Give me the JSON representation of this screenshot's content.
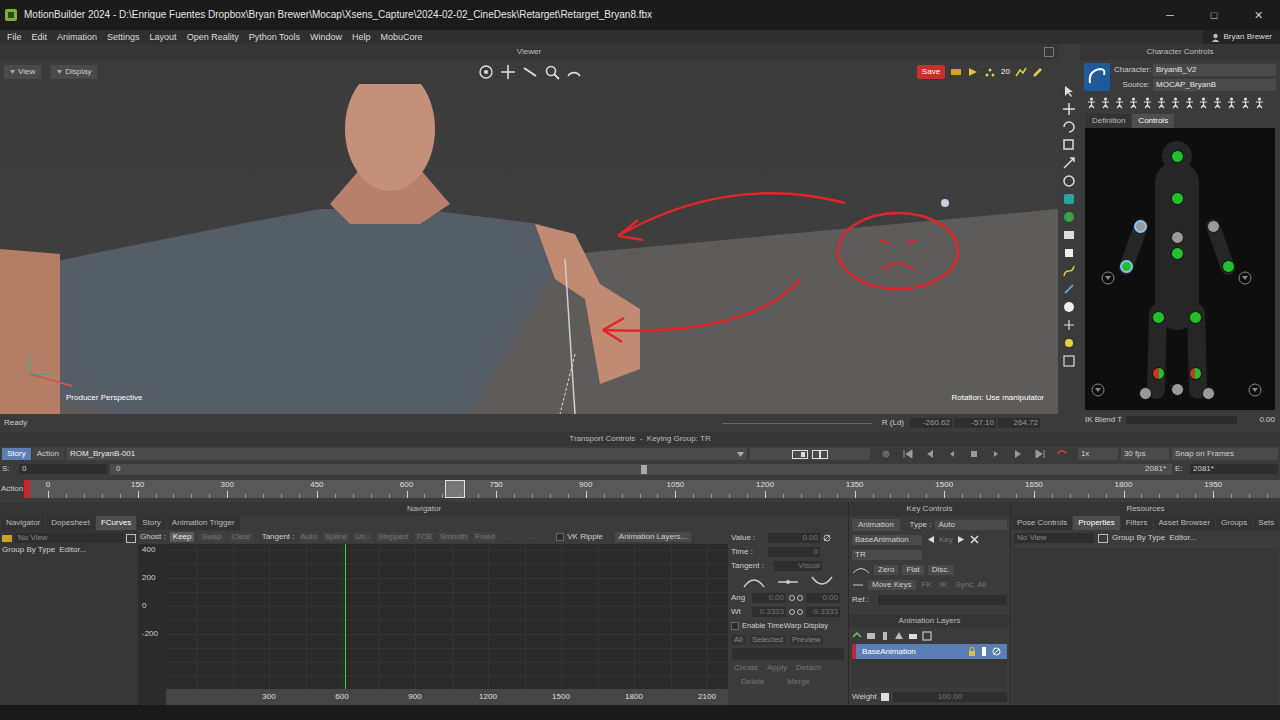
{
  "window": {
    "title": "MotionBuilder 2024 - D:\\Enrique Fuentes Dropbox\\Bryan Brewer\\Mocap\\Xsens_Capture\\2024-02-02_CineDesk\\Retarget\\Retarget_Bryan8.fbx",
    "controls": [
      "─",
      "□",
      "✕"
    ]
  },
  "menu": [
    "File",
    "Edit",
    "Animation",
    "Settings",
    "Layout",
    "Open Reality",
    "Python Tools",
    "Window",
    "Help",
    "MobuCore"
  ],
  "user": {
    "name": "Bryan Brewer"
  },
  "viewer": {
    "title": "Viewer",
    "buttons": [
      "View",
      "Display"
    ],
    "save": "Save",
    "speed": "20",
    "camera": "Producer Perspective",
    "hint": "Rotation: Use manipulator"
  },
  "status_bar": {
    "text": "Ready",
    "rot_label": "R (Ld)",
    "fields": [
      "-260.62",
      "-57.10",
      "264.72"
    ]
  },
  "character_controls": {
    "title": "Character Controls",
    "character_label": "Character:",
    "character": "BryanB_V2",
    "source_label": "Source:",
    "source": "MOCAP_BryanB",
    "tabs": [
      {
        "label": "Definition",
        "selected": false
      },
      {
        "label": "Controls",
        "selected": true
      }
    ],
    "effectors": [
      {
        "kind": "full",
        "color": "#22c02a",
        "color2": "#22c02a",
        "selected": false
      },
      {
        "kind": "full",
        "color": "#22c02a",
        "color2": "#22c02a",
        "selected": false
      },
      {
        "kind": "full",
        "color": "#9a9a9a",
        "color2": "#9a9a9a",
        "selected": true
      },
      {
        "kind": "full",
        "color": "#9a9a9a",
        "color2": "#9a9a9a",
        "selected": false
      },
      {
        "kind": "full",
        "color": "#9a9a9a",
        "color2": "#9a9a9a",
        "selected": false
      },
      {
        "kind": "full",
        "color": "#22c02a",
        "color2": "#22c02a",
        "selected": false
      },
      {
        "kind": "full",
        "color": "#22c02a",
        "color2": "#22c02a",
        "selected": true
      },
      {
        "kind": "full",
        "color": "#22c02a",
        "color2": "#22c02a",
        "selected": false
      },
      {
        "kind": "full",
        "color": "#22c02a",
        "color2": "#22c02a",
        "selected": false
      },
      {
        "kind": "full",
        "color": "#22c02a",
        "color2": "#22c02a",
        "selected": false
      },
      {
        "kind": "split",
        "color": "#c0392b",
        "color2": "#22c02a",
        "selected": false
      },
      {
        "kind": "split",
        "color": "#c0392b",
        "color2": "#22c02a",
        "selected": false
      },
      {
        "kind": "full",
        "color": "#9a9a9a",
        "color2": "#9a9a9a",
        "selected": false
      },
      {
        "kind": "full",
        "color": "#9a9a9a",
        "color2": "#9a9a9a",
        "selected": false
      },
      {
        "kind": "full",
        "color": "#9a9a9a",
        "color2": "#9a9a9a",
        "selected": false
      }
    ],
    "ik_blend_label": "IK Blend T",
    "ik_blend_value": "0.00"
  },
  "transport": {
    "title": "Transport Controls  -  Keying Group: TR",
    "tabs": [
      {
        "label": "Story",
        "selected": true
      },
      {
        "label": "Action",
        "selected": false
      }
    ],
    "take": "ROM_BryanB-001",
    "speed": "1x",
    "fps": "30 fps",
    "snap": "Snap on Frames",
    "start_label": "S:",
    "start": "0",
    "zoom_start": "0",
    "zoom_end": "2081*",
    "end_label": "E:",
    "end": "2081*",
    "zoom": {
      "level": 0.5
    },
    "ruler_label": "Action",
    "ruler_ticks": [
      "0",
      "150",
      "300",
      "450",
      "600",
      "750",
      "900",
      "1050",
      "1200",
      "1350",
      "1500",
      "1650",
      "1800",
      "1950"
    ],
    "playhead": {
      "level": 0.34
    }
  },
  "navigator": {
    "title": "Navigator",
    "tabs": [
      {
        "label": "Navigator",
        "selected": false
      },
      {
        "label": "Dopesheet",
        "selected": false
      },
      {
        "label": "FCurves",
        "selected": true
      },
      {
        "label": "Story",
        "selected": false
      },
      {
        "label": "Animation Trigger",
        "selected": false
      }
    ],
    "sidebar": {
      "view": "No View",
      "group": "Group By Type",
      "editor": "Editor..."
    },
    "ghost_label": "Ghost :",
    "ghost_buttons": [
      {
        "label": "Keep",
        "selected": true,
        "disabled": false
      },
      {
        "label": "Swap",
        "selected": false,
        "disabled": true
      },
      {
        "label": "Clear",
        "selected": false,
        "disabled": true
      }
    ],
    "tangent_label": "Tangent :",
    "tangent_buttons": [
      {
        "label": "Auto",
        "disabled": true
      },
      {
        "label": "Spline",
        "disabled": true
      },
      {
        "label": "Un..",
        "disabled": true
      },
      {
        "label": "Stepped",
        "disabled": true
      },
      {
        "label": "TCB",
        "disabled": true
      },
      {
        "label": "Smooth",
        "disabled": true
      },
      {
        "label": "Fixed",
        "disabled": true
      }
    ],
    "more_buttons": [
      "...",
      "..."
    ],
    "vk_ripple": {
      "label": "VK Ripple",
      "checked": false
    },
    "layers_button": "Animation Layers...",
    "graph": {
      "y_ticks": [
        "400",
        "200",
        "0",
        "-200"
      ],
      "x_ticks": [
        "300",
        "600",
        "900",
        "1200",
        "1500",
        "1800",
        "2100"
      ],
      "playhead": {
        "level": 0.35
      }
    },
    "key_panel": {
      "value_label": "Value :",
      "value": "0.00",
      "time_label": "Time :",
      "time": "0",
      "tangent_label": "Tangent :",
      "tangent": "Visual",
      "ang_label": "Ang",
      "ang": [
        "0.00",
        "0.00"
      ],
      "wt_label": "Wt",
      "wt": [
        "0.3333",
        "0.3333"
      ],
      "timewarp": {
        "label": "Enable TimeWarp Display",
        "checked": false
      },
      "filters": [
        "All",
        "Selected",
        "Preview"
      ],
      "actions": [
        "Create",
        "Apply",
        "Detach"
      ],
      "actions2": [
        "Delete",
        "Merge"
      ]
    }
  },
  "key_controls": {
    "title": "Key Controls",
    "animation_label": "Animation",
    "type_label": "Type :",
    "type": "Auto",
    "layer": "BaseAnimation",
    "key_label": "Key",
    "group": "TR",
    "buttons": [
      "Zero",
      "Flat",
      "Disc."
    ],
    "move_keys": "Move Keys",
    "mode_buttons": [
      "FK",
      "IK",
      "Sync. All"
    ],
    "ref_label": "Ref.:",
    "layers_title": "Animation Layers",
    "layers": [
      {
        "name": "BaseAnimation",
        "selected": true
      }
    ],
    "weight_label": "Weight",
    "weight": "100.00"
  },
  "resources": {
    "title": "Resources",
    "tabs": [
      {
        "label": "Pose Controls",
        "selected": false
      },
      {
        "label": "Properties",
        "selected": true
      },
      {
        "label": "Filters",
        "selected": false
      },
      {
        "label": "Asset Browser",
        "selected": false
      },
      {
        "label": "Groups",
        "selected": false
      },
      {
        "label": "Sets",
        "selected": false
      }
    ],
    "view": "No View",
    "group": "Group By Type",
    "editor": "Editor..."
  }
}
